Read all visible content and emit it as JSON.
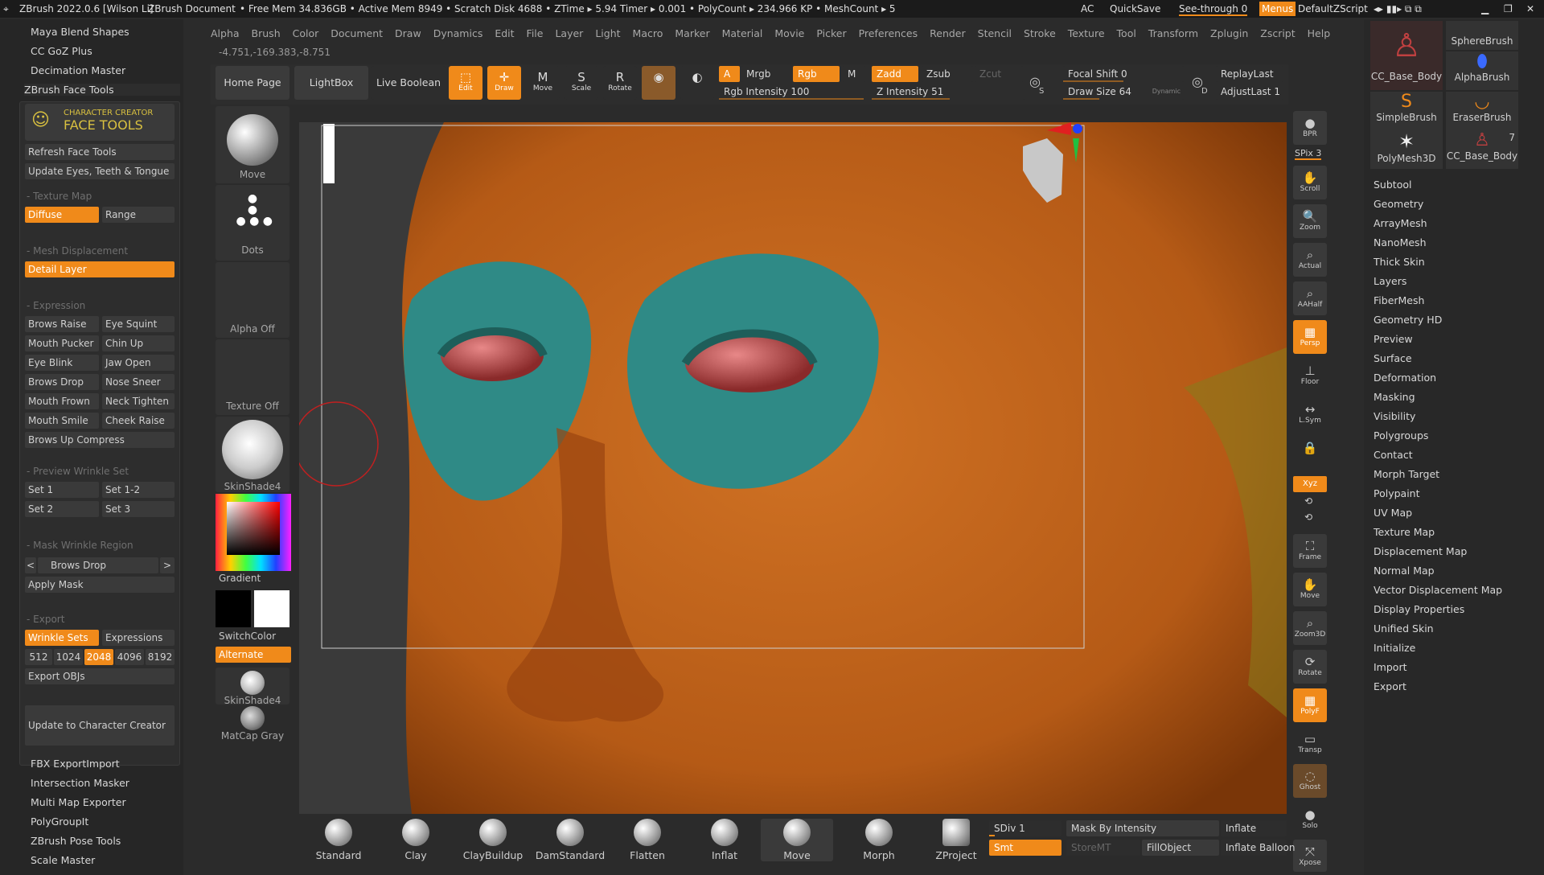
{
  "titlebar": {
    "app": "ZBrush 2022.0.6 [Wilson Li]",
    "doc": "ZBrush Document",
    "stats": "• Free Mem 34.836GB • Active Mem 8949 • Scratch Disk 4688 • ZTime ▸ 5.94 Timer ▸ 0.001 • PolyCount ▸ 234.966 KP • MeshCount ▸ 5",
    "ac": "AC",
    "quicksave": "QuickSave",
    "seethrough": "See-through  0",
    "menus": "Menus",
    "zscript": "DefaultZScript"
  },
  "menu": [
    "Alpha",
    "Brush",
    "Color",
    "Document",
    "Draw",
    "Dynamics",
    "Edit",
    "File",
    "Layer",
    "Light",
    "Macro",
    "Marker",
    "Material",
    "Movie",
    "Picker",
    "Preferences",
    "Render",
    "Stencil",
    "Stroke",
    "Texture",
    "Tool",
    "Transform",
    "Zplugin",
    "Zscript",
    "Help"
  ],
  "coords": "-4.751,-169.383,-8.751",
  "left_plugins_top": [
    "Maya Blend Shapes",
    "CC GoZ Plus",
    "Decimation Master",
    "ZBrush Face Tools"
  ],
  "face_tools": {
    "logo_line1": "CHARACTER CREATOR",
    "logo_line2": "FACE TOOLS",
    "refresh": "Refresh Face Tools",
    "update_eyes": "Update Eyes, Teeth & Tongue",
    "sec_texture": "- Texture Map",
    "diffuse": "Diffuse",
    "range": "Range",
    "sec_mesh": "- Mesh Displacement",
    "detail": "Detail Layer",
    "sec_expr": "- Expression",
    "expressions": [
      [
        "Brows Raise",
        "Eye Squint"
      ],
      [
        "Mouth Pucker",
        "Chin Up"
      ],
      [
        "Eye Blink",
        "Jaw Open"
      ],
      [
        "Brows Drop",
        "Nose Sneer"
      ],
      [
        "Mouth Frown",
        "Neck Tighten"
      ],
      [
        "Mouth Smile",
        "Cheek Raise"
      ],
      [
        "Brows Up Compress",
        ""
      ]
    ],
    "sec_preview": "- Preview Wrinkle Set",
    "sets": [
      [
        "Set 1",
        "Set 1-2"
      ],
      [
        "Set 2",
        "Set 3"
      ]
    ],
    "sec_mask": "- Mask Wrinkle Region",
    "mask_region": "Brows Drop",
    "apply_mask": "Apply Mask",
    "sec_export": "- Export",
    "wrinkle_sets": "Wrinkle Sets",
    "expr_btn": "Expressions",
    "sizes": [
      "512",
      "1024",
      "2048",
      "4096",
      "8192"
    ],
    "export_objs": "Export OBJs",
    "update_cc": "Update to Character Creator"
  },
  "left_plugins_bottom": [
    "FBX ExportImport",
    "Intersection Masker",
    "Multi Map Exporter",
    "PolyGroupIt",
    "ZBrush Pose Tools",
    "Scale Master"
  ],
  "shelf": {
    "home": "Home Page",
    "lightbox": "LightBox",
    "liveboolean": "Live Boolean",
    "edit": "Edit",
    "draw": "Draw",
    "move": "Move",
    "scale": "Scale",
    "rotate": "Rotate",
    "a": "A",
    "mrgb": "Mrgb",
    "rgb": "Rgb",
    "m": "M",
    "zadd": "Zadd",
    "zsub": "Zsub",
    "zcut": "Zcut",
    "rgb_intensity": "Rgb Intensity 100",
    "z_intensity": "Z Intensity 51",
    "focal": "Focal Shift 0",
    "drawsize": "Draw Size 64",
    "dynamic": "Dynamic",
    "s": "S",
    "d": "D",
    "replay": "ReplayLast",
    "adjust": "AdjustLast 1"
  },
  "tray": {
    "move": "Move",
    "dots": "Dots",
    "alpha": "Alpha Off",
    "texture": "Texture Off",
    "skinshade": "SkinShade4",
    "gradient": "Gradient",
    "switchcolor": "SwitchColor",
    "alternate": "Alternate",
    "skinshade2": "SkinShade4",
    "matcap": "MatCap Gray"
  },
  "righttools": [
    "BPR",
    "SPix 3",
    "Scroll",
    "Zoom",
    "Actual",
    "AAHalf",
    "Persp",
    "Floor",
    "L.Sym",
    "",
    "Xyz",
    "",
    "",
    "Frame",
    "Move",
    "Zoom3D",
    "Rotate",
    "PolyF",
    "Transp",
    "Ghost",
    "Solo",
    "Xpose"
  ],
  "brushes": [
    [
      "CC_Base_Body",
      "SphereBrush"
    ],
    [
      "",
      "AlphaBrush"
    ],
    [
      "SimpleBrush",
      "EraserBrush"
    ],
    [
      "PolyMesh3D",
      "CC_Base_Body"
    ]
  ],
  "brush_count": "7",
  "subtools": [
    "Subtool",
    "Geometry",
    "ArrayMesh",
    "NanoMesh",
    "Thick Skin",
    "Layers",
    "FiberMesh",
    "Geometry HD",
    "Preview",
    "Surface",
    "Deformation",
    "Masking",
    "Visibility",
    "Polygroups",
    "Contact",
    "Morph Target",
    "Polypaint",
    "UV Map",
    "Texture Map",
    "Displacement Map",
    "Normal Map",
    "Vector Displacement Map",
    "Display Properties",
    "Unified Skin",
    "Initialize",
    "Import",
    "Export"
  ],
  "bottom_brushes": [
    "Standard",
    "Clay",
    "ClayBuildup",
    "DamStandard",
    "Flatten",
    "Inflat",
    "Move",
    "Morph",
    "ZProject"
  ],
  "bottom_controls": {
    "sdiv": "SDiv 1",
    "smt": "Smt",
    "mask_intensity": "Mask By Intensity",
    "storemt": "StoreMT",
    "fillobject": "FillObject",
    "inflate": "Inflate",
    "inflate_balloon": "Inflate Balloon"
  },
  "colors": {
    "accent": "#f08a1a",
    "panel": "#2d2d2d",
    "skin": "#c1621a",
    "teal": "#2f8a86"
  }
}
